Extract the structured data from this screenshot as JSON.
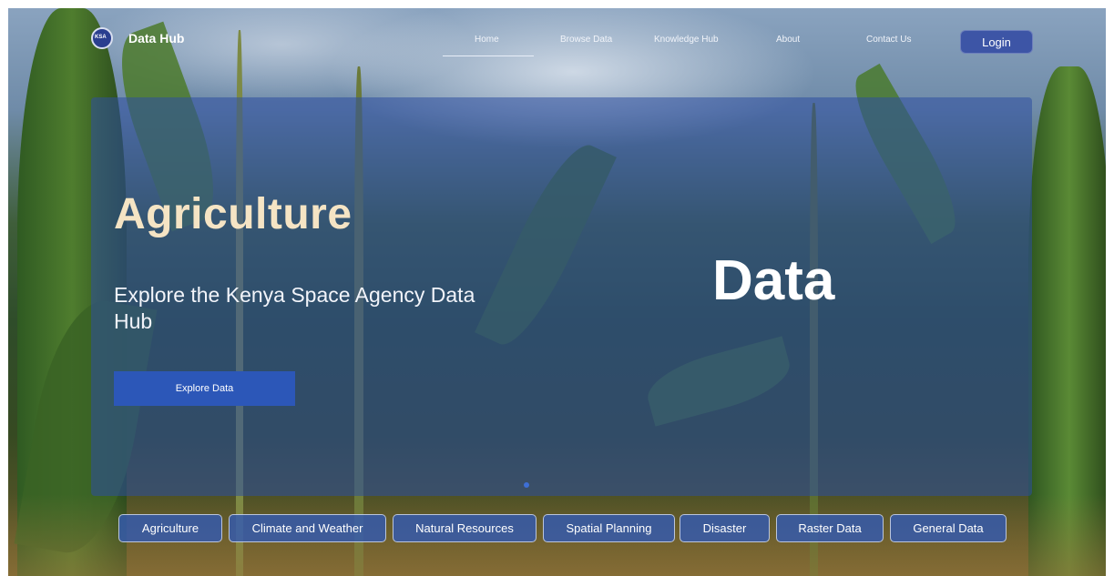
{
  "header": {
    "brand": "Data Hub",
    "logo_text": "KSA",
    "nav": [
      "Home",
      "Browse Data",
      "Knowledge Hub",
      "About",
      "Contact Us"
    ],
    "active_nav": "Home",
    "login_label": "Login"
  },
  "hero": {
    "title": "Agriculture",
    "subtitle": "Explore the Kenya Space Agency Data Hub",
    "big_word": "Data",
    "cta_label": "Explore Data"
  },
  "categories": [
    "Agriculture",
    "Climate and Weather",
    "Natural Resources",
    "Spatial Planning",
    "Disaster",
    "Raster Data",
    "General Data"
  ],
  "colors": {
    "panel": "#2d4ea0",
    "title": "#f5e4c4",
    "accent": "#2c57b8"
  }
}
